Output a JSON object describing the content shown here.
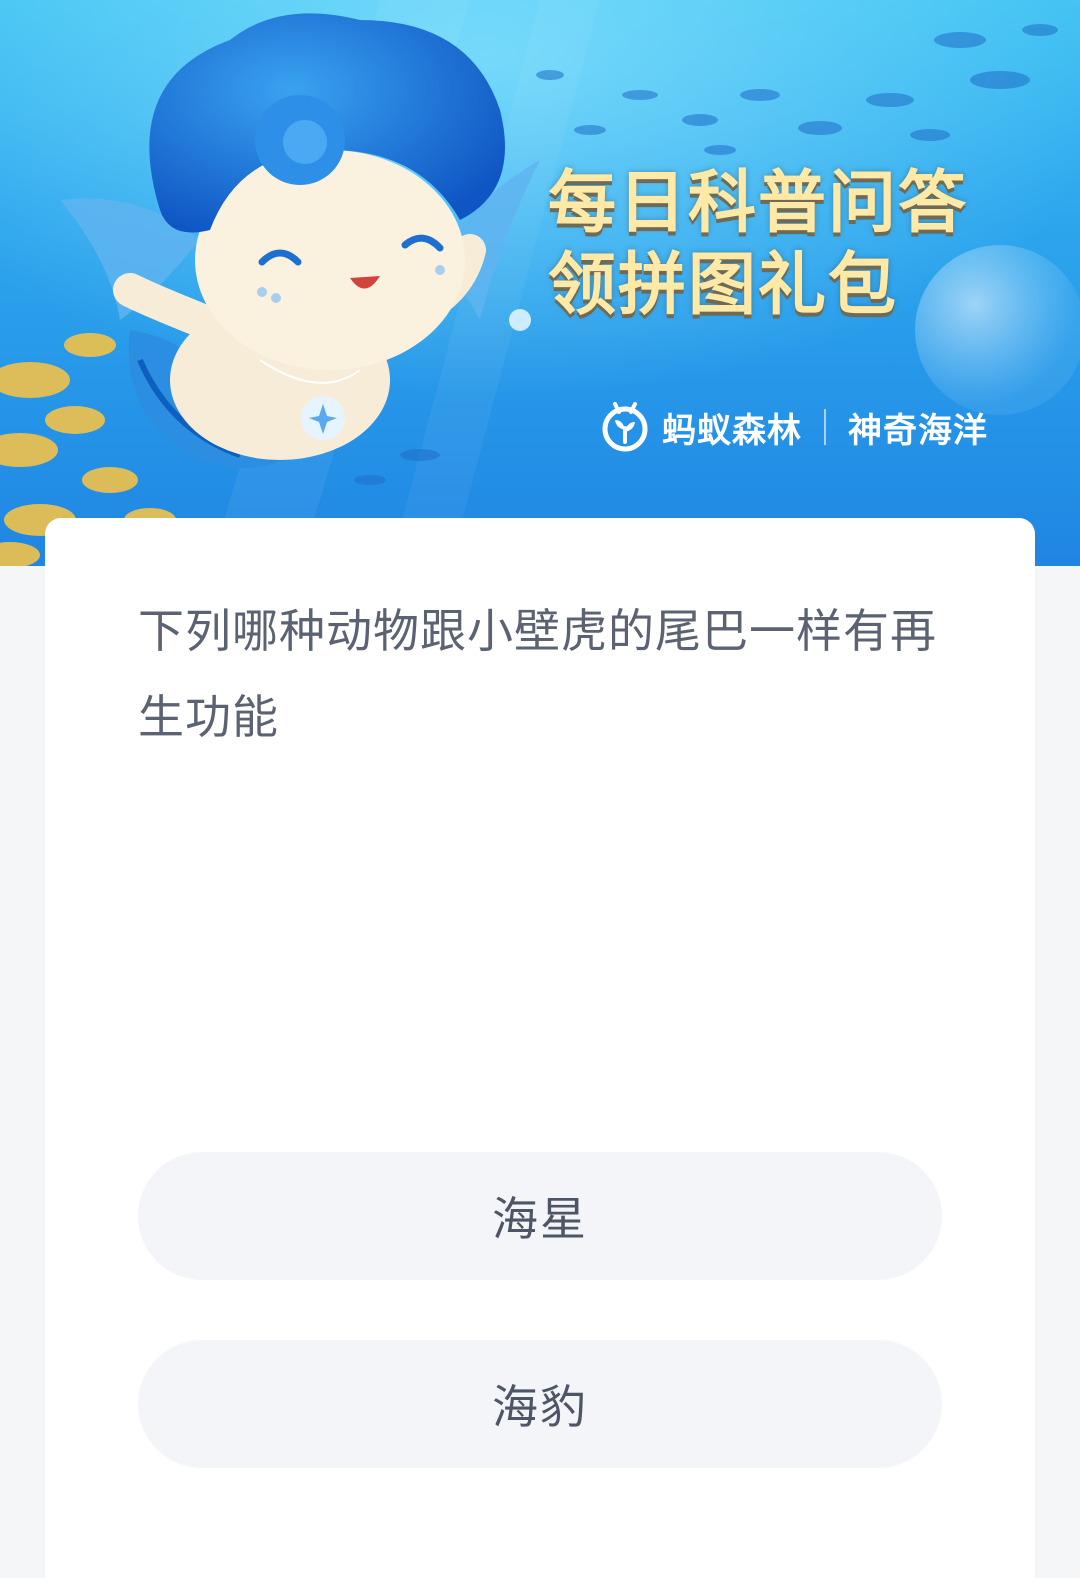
{
  "banner": {
    "title_line1": "每日科普问答",
    "title_line2": "领拼图礼包",
    "brand_name": "蚂蚁森林",
    "brand_partner": "神奇海洋"
  },
  "quiz": {
    "question": "下列哪种动物跟小壁虎的尾巴一样有再生功能",
    "options": [
      {
        "label": "海星"
      },
      {
        "label": "海豹"
      }
    ]
  },
  "colors": {
    "banner_top": "#3fc2f2",
    "banner_bottom": "#1f86e3",
    "title_gold": "#ffe9a6",
    "question_text": "#5b6373",
    "option_bg": "#f3f5f8",
    "page_bg": "#f5f6f7"
  }
}
